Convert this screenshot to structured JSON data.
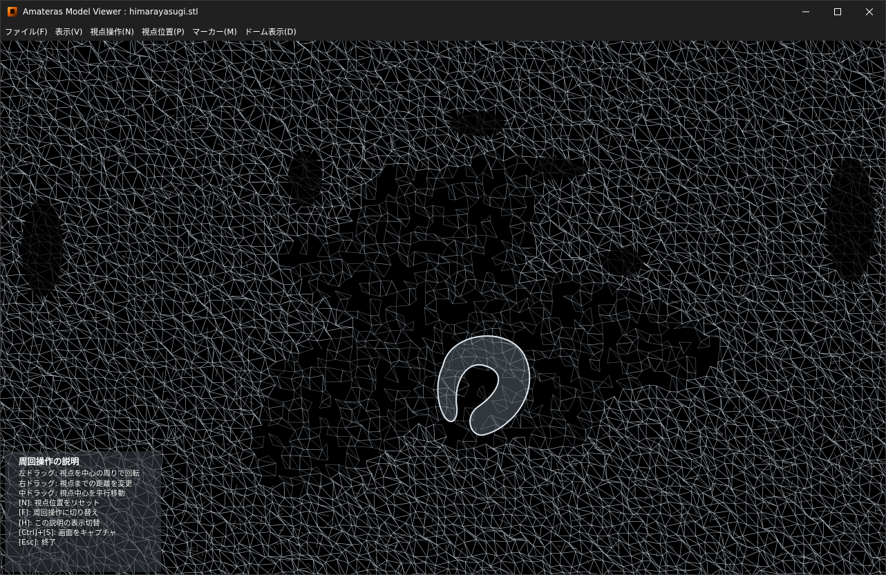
{
  "window": {
    "title": "Amateras Model Viewer : himarayasugi.stl"
  },
  "menu": {
    "items": [
      {
        "id": "file",
        "label": "ファイル(F)"
      },
      {
        "id": "view",
        "label": "表示(V)"
      },
      {
        "id": "view-op",
        "label": "視点操作(N)"
      },
      {
        "id": "view-pos",
        "label": "視点位置(P)"
      },
      {
        "id": "marker",
        "label": "マーカー(M)"
      },
      {
        "id": "dome",
        "label": "ドーム表示(D)"
      }
    ]
  },
  "help": {
    "title": "周回操作の説明",
    "lines": [
      "左ドラッグ: 視点を中心の周りで回転",
      "右ドラッグ: 視点までの距離を変更",
      "中ドラッグ: 視点中心を平行移動",
      "[N]: 視点位置をリセット",
      "[F]: 周回操作に切り替え",
      "[H]: この説明の表示切替",
      "[Ctrl]+[S]: 画面をキャプチャ",
      "[Esc]: 終了"
    ]
  },
  "colors": {
    "mesh": "#c8d4e0",
    "background": "#000000",
    "titlebar": "#202020"
  },
  "icons": {
    "app": "app-icon",
    "minimize": "minimize-icon",
    "maximize": "maximize-icon",
    "close": "close-icon"
  }
}
